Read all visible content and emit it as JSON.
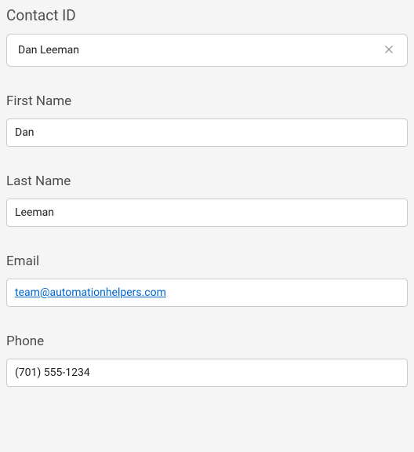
{
  "fields": {
    "contact_id": {
      "label": "Contact ID",
      "value": "Dan Leeman"
    },
    "first_name": {
      "label": "First Name",
      "value": "Dan"
    },
    "last_name": {
      "label": "Last Name",
      "value": "Leeman"
    },
    "email": {
      "label": "Email",
      "value": "team@automationhelpers.com"
    },
    "phone": {
      "label": "Phone",
      "value": "(701) 555-1234"
    }
  }
}
